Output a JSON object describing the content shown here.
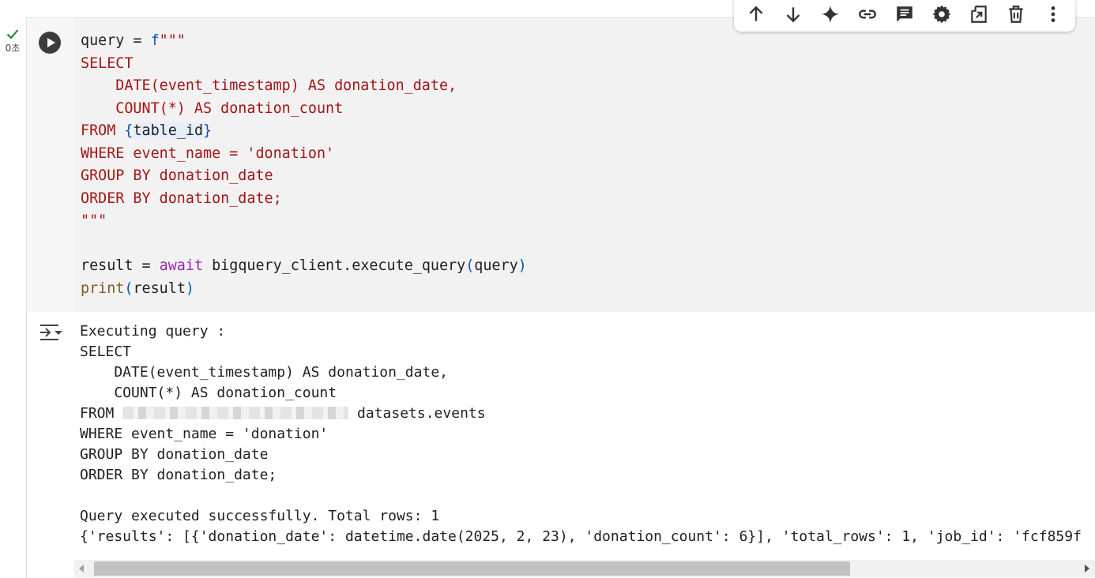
{
  "gutter": {
    "exec_time": "0초",
    "status_color": "#188038"
  },
  "toolbar": {
    "buttons": [
      "arrow-up-icon",
      "arrow-down-icon",
      "sparkle-icon",
      "link-icon",
      "comment-icon",
      "gear-icon",
      "mirror-cell-icon",
      "trash-icon",
      "more-vert-icon"
    ]
  },
  "code": {
    "l1_var": "query = ",
    "l1_f": "f",
    "l1_q": "\"\"\"",
    "l2": "SELECT",
    "l3": "    DATE(event_timestamp) AS donation_date,",
    "l4": "    COUNT(*) AS donation_count",
    "l5_pre": "FROM ",
    "l5_open": "{",
    "l5_var": "table_id",
    "l5_close": "}",
    "l6": "WHERE event_name = 'donation'",
    "l7": "GROUP BY donation_date",
    "l8": "ORDER BY donation_date;",
    "l9": "\"\"\"",
    "l11_pre": "result = ",
    "l11_await": "await",
    "l11_call": " bigquery_client.execute_query",
    "l11_open": "(",
    "l11_arg": "query",
    "l11_close": ")",
    "l12_print": "print",
    "l12_open": "(",
    "l12_arg": "result",
    "l12_close": ")"
  },
  "output": {
    "o1": "Executing query :",
    "o2": "SELECT",
    "o3": "    DATE(event_timestamp) AS donation_date,",
    "o4": "    COUNT(*) AS donation_count",
    "o5_pre": "FROM ",
    "o5_post": " datasets.events",
    "o6": "WHERE event_name = 'donation'",
    "o7": "GROUP BY donation_date",
    "o8": "ORDER BY donation_date;",
    "o10": "Query executed successfully. Total rows: 1",
    "o11": "{'results': [{'donation_date': datetime.date(2025, 2, 23), 'donation_count': 6}], 'total_rows': 1, 'job_id': 'fcf859f"
  },
  "scrollbar": {
    "visible_fraction": 0.77
  }
}
